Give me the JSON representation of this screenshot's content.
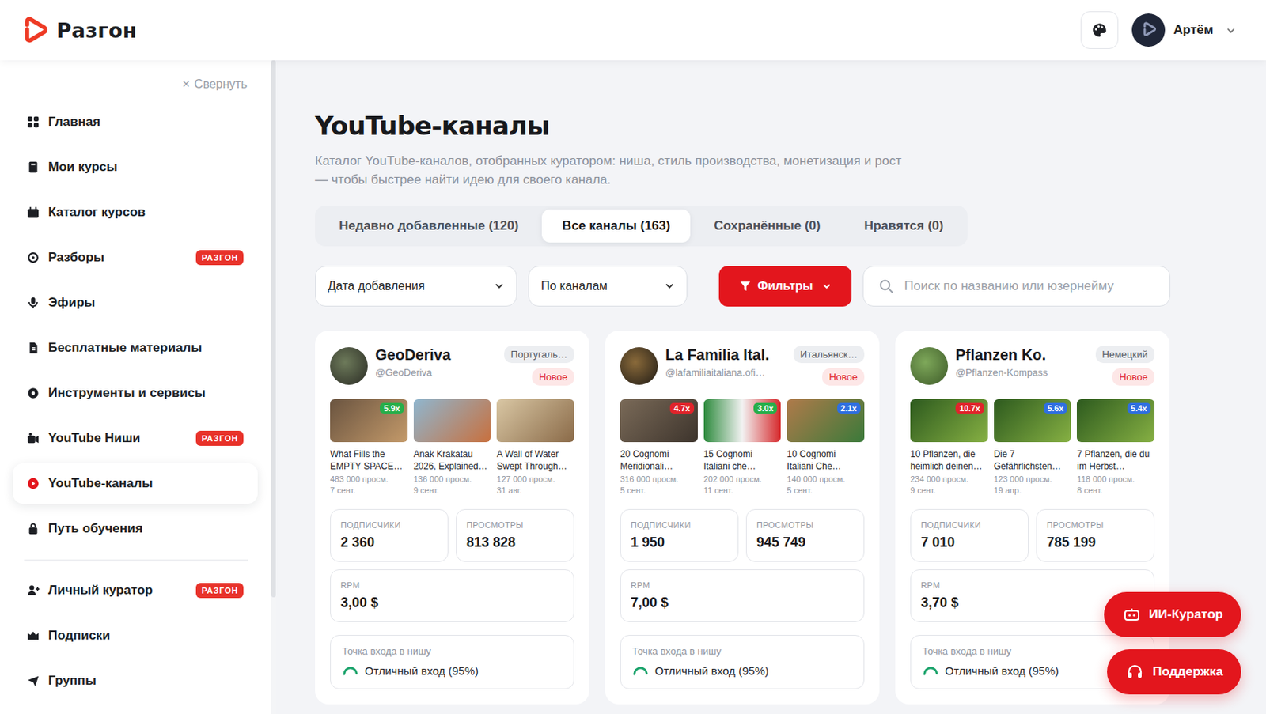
{
  "header": {
    "logo": "Разгон",
    "user": {
      "name": "Артём"
    }
  },
  "sidebar": {
    "collapse": {
      "icon": "×",
      "label": "Свернуть"
    },
    "groups": [
      {
        "items": [
          {
            "label": "Главная",
            "selected": false
          },
          {
            "label": "Мои курсы",
            "selected": false
          },
          {
            "label": "Каталог курсов",
            "selected": false
          },
          {
            "label": "Разборы",
            "badge": "РАЗГОН",
            "selected": false
          },
          {
            "label": "Эфиры",
            "selected": false
          },
          {
            "label": "Бесплатные материалы",
            "selected": false
          },
          {
            "label": "Инструменты и сервисы",
            "selected": false
          },
          {
            "label": "YouTube Ниши",
            "badge": "РАЗГОН",
            "selected": false
          },
          {
            "label": "YouTube-каналы",
            "selected": true
          },
          {
            "label": "Путь обучения",
            "selected": false
          }
        ]
      },
      {
        "items": [
          {
            "label": "Личный куратор",
            "badge": "РАЗГОН",
            "selected": false
          },
          {
            "label": "Подписки",
            "selected": false
          },
          {
            "label": "Группы",
            "selected": false
          }
        ]
      }
    ]
  },
  "page": {
    "title": "YouTube-каналы",
    "description": "Каталог YouTube-каналов, отобранных куратором: ниша, стиль производства, монетизация и рост — чтобы быстрее найти идею для своего канала."
  },
  "tabs": [
    {
      "label": "Недавно добавленные (120)",
      "selected": false
    },
    {
      "label": "Все каналы (163)",
      "selected": true
    },
    {
      "label": "Сохранённые (0)",
      "selected": false
    },
    {
      "label": "Нравятся (0)",
      "selected": false
    }
  ],
  "toolbar": {
    "sort": "Дата добавления",
    "group": "По каналам",
    "filters": "Фильтры",
    "search": {
      "placeholder": "Поиск по названию или юзернейму"
    }
  },
  "channels": [
    {
      "name": "GeoDeriva",
      "handle": "@GeoDeriva",
      "language": "Португаль…",
      "badge": "Новое",
      "videos": [
        {
          "title": "What Fills the EMPTY SPACE…",
          "views": "483 000 просм.",
          "date": "7 сент.",
          "multiplier": "5.9x",
          "color": "#27ae4a"
        },
        {
          "title": "Anak Krakatau 2026, Explained…",
          "views": "136 000 просм.",
          "date": "9 сент."
        },
        {
          "title": "A Wall of Water Swept Through…",
          "views": "127 000 просм.",
          "date": "31 авг."
        }
      ],
      "stats": [
        {
          "label": "ПОДПИСЧИКИ",
          "value": "2 360"
        },
        {
          "label": "ПРОСМОТРЫ",
          "value": "813 828"
        }
      ],
      "rpm": {
        "label": "RPM",
        "value": "3,00 $"
      },
      "entry": {
        "label": "Точка входа в нишу",
        "value": "Отличный вход (95%)",
        "level": 0.95
      }
    },
    {
      "name": "La Familia Ital.",
      "handle": "@lafamiliaitaliana.ofi…",
      "language": "Итальянск…",
      "badge": "Новое",
      "videos": [
        {
          "title": "20 Cognomi Meridionali…",
          "views": "316 000 просм.",
          "date": "5 сент.",
          "multiplier": "4.7x",
          "color": "#e0242b"
        },
        {
          "title": "15 Cognomi Italiani che…",
          "views": "202 000 просм.",
          "date": "11 сент.",
          "multiplier": "3.0x",
          "color": "#27ae4a"
        },
        {
          "title": "10 Cognomi Italiani Che…",
          "views": "140 000 просм.",
          "date": "5 сент.",
          "multiplier": "2.1x",
          "color": "#2f6fe0"
        }
      ],
      "stats": [
        {
          "label": "ПОДПИСЧИКИ",
          "value": "1 950"
        },
        {
          "label": "ПРОСМОТРЫ",
          "value": "945 749"
        }
      ],
      "rpm": {
        "label": "RPM",
        "value": "7,00 $"
      },
      "entry": {
        "label": "Точка входа в нишу",
        "value": "Отличный вход (95%)",
        "level": 0.95
      }
    },
    {
      "name": "Pflanzen Ko.",
      "handle": "@Pflanzen-Kompass",
      "language": "Немецкий",
      "badge": "Новое",
      "videos": [
        {
          "title": "10 Pflanzen, die heimlich deinen…",
          "views": "234 000 просм.",
          "date": "9 сент.",
          "multiplier": "10.7x",
          "color": "#e0242b"
        },
        {
          "title": "Die 7 Gefährlichsten…",
          "views": "123 000 просм.",
          "date": "19 апр.",
          "multiplier": "5.6x",
          "color": "#2f6fe0"
        },
        {
          "title": "7 Pflanzen, die du im Herbst…",
          "views": "118 000 просм.",
          "date": "8 сент.",
          "multiplier": "5.4x",
          "color": "#2f6fe0"
        }
      ],
      "stats": [
        {
          "label": "ПОДПИСЧИКИ",
          "value": "7 010"
        },
        {
          "label": "ПРОСМОТРЫ",
          "value": "785 199"
        }
      ],
      "rpm": {
        "label": "RPM",
        "value": "3,70 $"
      },
      "entry": {
        "label": "Точка входа в нишу",
        "value": "Отличный вход (95%)",
        "level": 0.95
      }
    }
  ],
  "floating_buttons": [
    "ИИ-Куратор",
    "Поддержка"
  ]
}
